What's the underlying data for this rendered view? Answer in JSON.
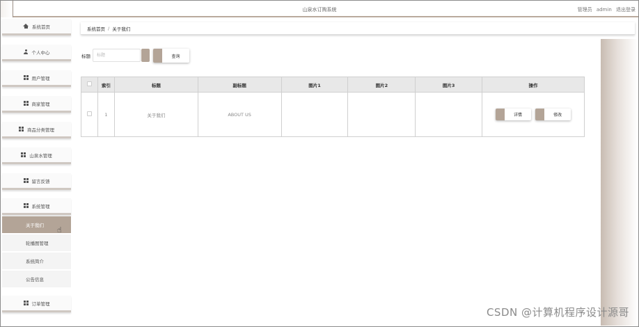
{
  "app": {
    "title": "山泉水订购系统",
    "user_role": "管理员",
    "username": "admin",
    "logout_label": "退出登录"
  },
  "sidebar": {
    "items": [
      {
        "label": "系统首页",
        "icon": "home-icon"
      },
      {
        "label": "个人中心",
        "icon": "user-icon"
      },
      {
        "label": "用户管理",
        "icon": "grid-icon"
      },
      {
        "label": "商家管理",
        "icon": "grid-icon"
      },
      {
        "label": "商品分类管理",
        "icon": "grid-icon"
      },
      {
        "label": "山泉水管理",
        "icon": "grid-icon"
      },
      {
        "label": "留言反馈",
        "icon": "grid-icon"
      },
      {
        "label": "系统管理",
        "icon": "grid-icon"
      },
      {
        "label": "订单管理",
        "icon": "grid-icon"
      }
    ],
    "sub_items": [
      {
        "label": "关于我们",
        "active": true
      },
      {
        "label": "轮播图管理",
        "active": false
      },
      {
        "label": "系统简介",
        "active": false
      },
      {
        "label": "公告信息",
        "active": false
      }
    ]
  },
  "breadcrumb": {
    "home": "系统首页",
    "separator": "/",
    "current": "关于我们"
  },
  "search": {
    "label": "标题",
    "placeholder": "标题",
    "button_label": "查询"
  },
  "table": {
    "headers": [
      "",
      "索引",
      "标题",
      "副标题",
      "图片1",
      "图片2",
      "图片3",
      "操作"
    ],
    "rows": [
      {
        "index": "1",
        "title": "关于我们",
        "subtitle": "ABOUT US",
        "image1": "",
        "image2": "",
        "image3": ""
      }
    ],
    "detail_label": "详情",
    "edit_label": "修改"
  },
  "watermark": "CSDN @计算机程序设计源哥",
  "colors": {
    "accent": "#b3a497",
    "topbar_border": "#b9aa9d"
  }
}
